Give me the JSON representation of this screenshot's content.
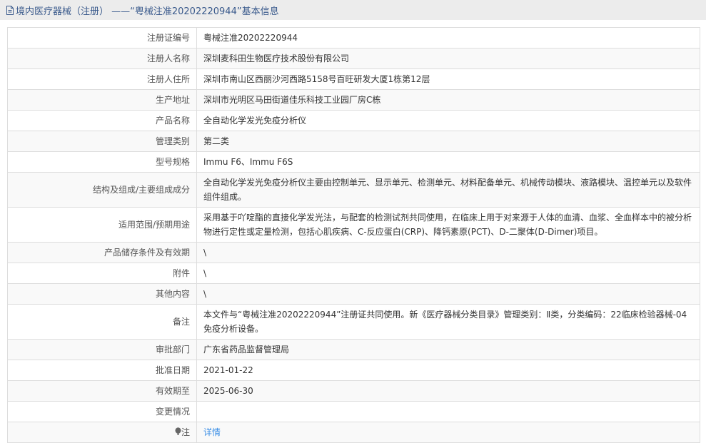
{
  "header": {
    "title": "境内医疗器械（注册）  ——“粤械注准20202220944”基本信息"
  },
  "rows": [
    {
      "label": "注册证编号",
      "value": "粤械注准20202220944"
    },
    {
      "label": "注册人名称",
      "value": "深圳麦科田生物医疗技术股份有限公司"
    },
    {
      "label": "注册人住所",
      "value": "深圳市南山区西丽沙河西路5158号百旺研发大厦1栋第12层"
    },
    {
      "label": "生产地址",
      "value": "深圳市光明区马田街道佳乐科技工业园厂房C栋"
    },
    {
      "label": "产品名称",
      "value": "全自动化学发光免疫分析仪"
    },
    {
      "label": "管理类别",
      "value": "第二类"
    },
    {
      "label": "型号规格",
      "value": "Immu F6、Immu F6S"
    },
    {
      "label": "结构及组成/主要组成成分",
      "value": "全自动化学发光免疫分析仪主要由控制单元、显示单元、检测单元、材料配备单元、机械传动模块、液路模块、温控单元以及软件组件组成。"
    },
    {
      "label": "适用范围/预期用途",
      "value": "采用基于吖啶酯的直接化学发光法，与配套的检测试剂共同使用，在临床上用于对来源于人体的血清、血浆、全血样本中的被分析物进行定性或定量检测，包括心肌疾病、C-反应蛋白(CRP)、降钙素原(PCT)、D-二聚体(D-Dimer)项目。"
    },
    {
      "label": "产品储存条件及有效期",
      "value": "\\"
    },
    {
      "label": "附件",
      "value": "\\"
    },
    {
      "label": "其他内容",
      "value": "\\"
    },
    {
      "label": "备注",
      "value": "本文件与“粤械注准20202220944”注册证共同使用。新《医疗器械分类目录》管理类别：Ⅱ类，分类编码：22临床检验器械-04免疫分析设备。"
    },
    {
      "label": "审批部门",
      "value": "广东省药品监督管理局"
    },
    {
      "label": "批准日期",
      "value": "2021-01-22"
    },
    {
      "label": "有效期至",
      "value": "2025-06-30"
    },
    {
      "label": "变更情况",
      "value": ""
    }
  ],
  "note": {
    "label": "注",
    "link": "详情"
  }
}
